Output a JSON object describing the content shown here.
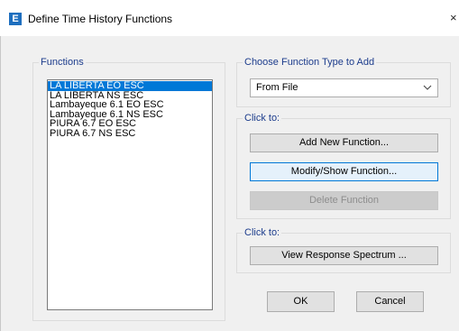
{
  "window": {
    "title": "Define Time History Functions",
    "app_icon_letter": "E",
    "close_glyph": "×"
  },
  "functions_group": {
    "label": "Functions",
    "items": [
      "LA LIBERTA EO ESC",
      "LA LIBERTA NS ESC",
      "Lambayeque 6.1 EO ESC",
      "Lambayeque 6.1 NS ESC",
      "PIURA 6.7 EO ESC",
      "PIURA 6.7 NS ESC"
    ],
    "selected_index": 0
  },
  "function_type_group": {
    "label": "Choose  Function Type to Add",
    "selected_value": "From File",
    "arrow_icon": "chevron-down-icon"
  },
  "actions_group": {
    "label": "Click to:",
    "add_new_label": "Add New Function...",
    "modify_show_label": "Modify/Show Function...",
    "delete_label": "Delete Function"
  },
  "spectrum_group": {
    "label": "Click to:",
    "view_spectrum_label": "View Response Spectrum ..."
  },
  "footer": {
    "ok_label": "OK",
    "cancel_label": "Cancel"
  },
  "colors": {
    "selection": "#0078d7",
    "group_label": "#1c3c8c",
    "app_icon": "#1e6fbf"
  }
}
